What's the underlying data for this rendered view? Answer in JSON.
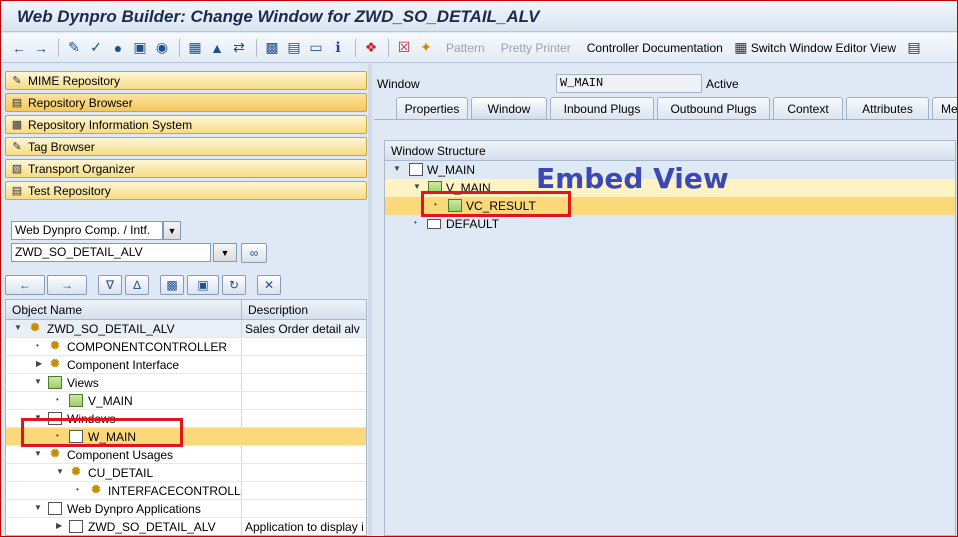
{
  "window_title": "Web Dynpro Builder: Change Window for ZWD_SO_DETAIL_ALV",
  "toolbar": {
    "pattern_label": "Pattern",
    "pretty_printer_label": "Pretty Printer",
    "controller_doc_label": "Controller Documentation",
    "switch_editor_label": "Switch Window Editor View"
  },
  "nav_buttons": [
    {
      "label": "MIME Repository",
      "icon": "mime-icon"
    },
    {
      "label": "Repository Browser",
      "icon": "repository-icon"
    },
    {
      "label": "Repository Information System",
      "icon": "info-system-icon"
    },
    {
      "label": "Tag Browser",
      "icon": "tag-icon"
    },
    {
      "label": "Transport Organizer",
      "icon": "transport-icon"
    },
    {
      "label": "Test Repository",
      "icon": "test-icon"
    }
  ],
  "object_type_select": "Web Dynpro Comp. / Intf.",
  "object_name_input": "ZWD_SO_DETAIL_ALV",
  "tree": {
    "col_object_name": "Object Name",
    "col_description": "Description",
    "rows": [
      {
        "label": "ZWD_SO_DETAIL_ALV",
        "desc": "Sales Order detail alv"
      },
      {
        "label": "COMPONENTCONTROLLER",
        "desc": ""
      },
      {
        "label": "Component Interface",
        "desc": ""
      },
      {
        "label": "Views",
        "desc": ""
      },
      {
        "label": "V_MAIN",
        "desc": ""
      },
      {
        "label": "Windows",
        "desc": ""
      },
      {
        "label": "W_MAIN",
        "desc": ""
      },
      {
        "label": "Component Usages",
        "desc": ""
      },
      {
        "label": "CU_DETAIL",
        "desc": ""
      },
      {
        "label": "INTERFACECONTROLLER",
        "desc": ""
      },
      {
        "label": "Web Dynpro Applications",
        "desc": ""
      },
      {
        "label": "ZWD_SO_DETAIL_ALV",
        "desc": "Application to display i"
      }
    ]
  },
  "window_field": {
    "label": "Window",
    "value": "W_MAIN",
    "status": "Active"
  },
  "tabs": [
    "Properties",
    "Window",
    "Inbound Plugs",
    "Outbound Plugs",
    "Context",
    "Attributes",
    "Me"
  ],
  "window_structure": {
    "header": "Window Structure",
    "rows": [
      {
        "label": "W_MAIN"
      },
      {
        "label": "V_MAIN"
      },
      {
        "label": "VC_RESULT"
      },
      {
        "label": "DEFAULT"
      }
    ]
  },
  "annotation": "Embed View",
  "colors": {
    "annotation_red": "#e0161e",
    "annotation_blue": "#3a49b5",
    "selection": "#fbd97a"
  }
}
